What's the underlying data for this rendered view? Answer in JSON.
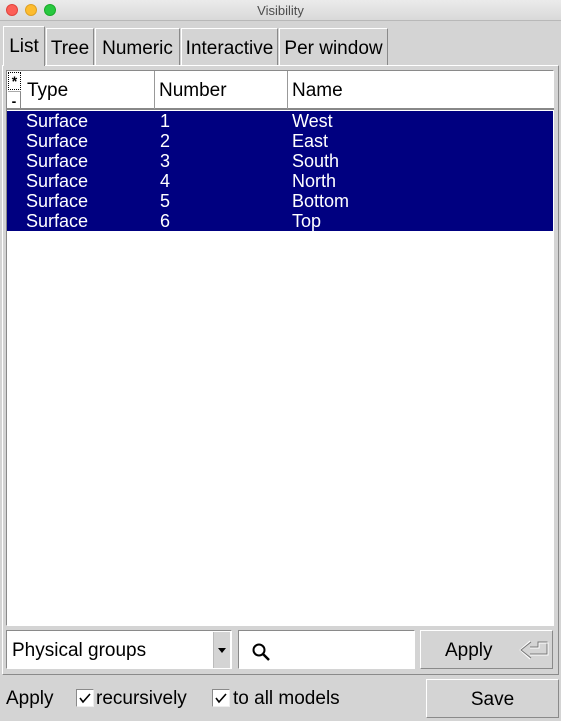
{
  "window": {
    "title": "Visibility"
  },
  "tabs": [
    {
      "label": "List",
      "active": true
    },
    {
      "label": "Tree",
      "active": false
    },
    {
      "label": "Numeric",
      "active": false
    },
    {
      "label": "Interactive",
      "active": false
    },
    {
      "label": "Per window",
      "active": false
    }
  ],
  "browser": {
    "select_all_label": "*",
    "select_none_label": "-",
    "columns": [
      "Type",
      "Number",
      "Name"
    ],
    "rows": [
      {
        "type": "Surface",
        "number": "1",
        "name": "West",
        "selected": true
      },
      {
        "type": "Surface",
        "number": "2",
        "name": "East",
        "selected": true
      },
      {
        "type": "Surface",
        "number": "3",
        "name": "South",
        "selected": true
      },
      {
        "type": "Surface",
        "number": "4",
        "name": "North",
        "selected": true
      },
      {
        "type": "Surface",
        "number": "5",
        "name": "Bottom",
        "selected": true
      },
      {
        "type": "Surface",
        "number": "6",
        "name": "Top",
        "selected": true
      }
    ],
    "selection_color": "#000080"
  },
  "controls": {
    "group_type": "Physical groups",
    "search_value": "",
    "search_icon": "search-icon",
    "apply_label": "Apply",
    "apply_icon": "enter-return-icon"
  },
  "footer": {
    "apply_label": "Apply",
    "recursively": {
      "label": "recursively",
      "checked": true
    },
    "all_models": {
      "label": "to all models",
      "checked": true
    },
    "save_label": "Save"
  }
}
